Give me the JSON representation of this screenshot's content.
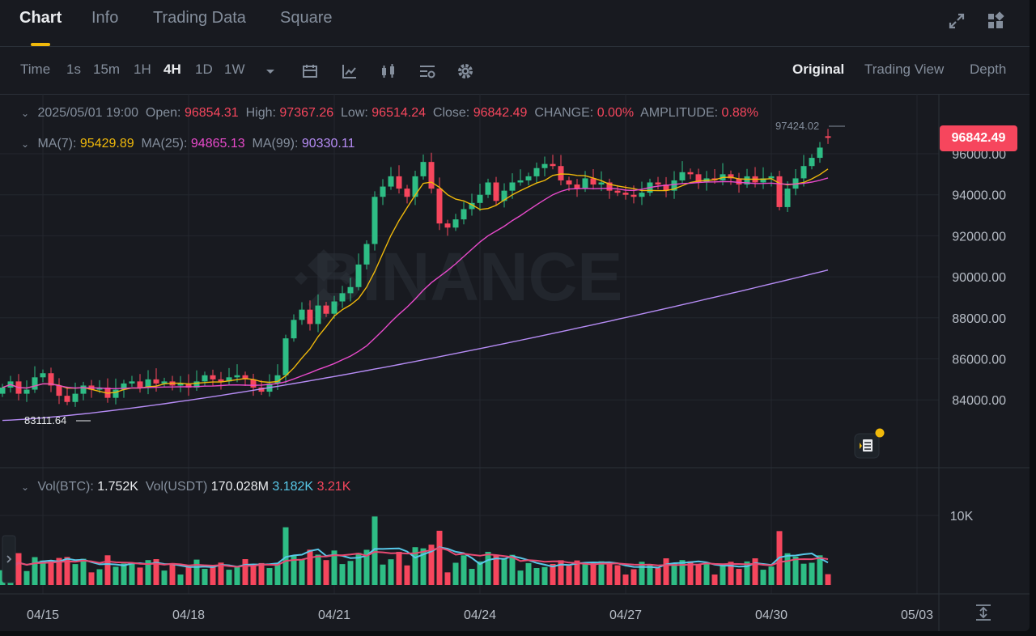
{
  "tabs": [
    {
      "label": "Chart",
      "active": true
    },
    {
      "label": "Info",
      "active": false
    },
    {
      "label": "Trading Data",
      "active": false
    },
    {
      "label": "Square",
      "active": false
    }
  ],
  "toolbar": {
    "intervals": [
      "Time",
      "1s",
      "15m",
      "1H",
      "4H",
      "1D",
      "1W"
    ],
    "active_interval": "4H",
    "views": [
      "Original",
      "Trading View",
      "Depth"
    ],
    "active_view": "Original"
  },
  "ohlc": {
    "datetime": "2025/05/01 19:00",
    "open_label": "Open:",
    "open": "96854.31",
    "high_label": "High:",
    "high": "97367.26",
    "low_label": "Low:",
    "low": "96514.24",
    "close_label": "Close:",
    "close": "96842.49",
    "change_label": "CHANGE:",
    "change": "0.00%",
    "amplitude_label": "AMPLITUDE:",
    "amplitude": "0.88%"
  },
  "ma": {
    "ma7_label": "MA(7):",
    "ma7": "95429.89",
    "ma25_label": "MA(25):",
    "ma25": "94865.13",
    "ma99_label": "MA(99):",
    "ma99": "90330.11"
  },
  "volume": {
    "btc_label": "Vol(BTC):",
    "btc": "1.752K",
    "usdt_label": "Vol(USDT)",
    "usdt": "170.028M",
    "ma1": "3.182K",
    "ma2": "3.21K"
  },
  "markers": {
    "high_marker": "97424.02",
    "low_marker": "83111.64",
    "current_price": "96842.49"
  },
  "watermark": "BINANCE",
  "colors": {
    "up": "#2ebd85",
    "down": "#f6465d",
    "ma7": "#f0b90b",
    "ma25": "#e84acb",
    "ma99": "#b68cf5",
    "accent": "#f0b90b"
  },
  "chart_data": {
    "type": "candlestick",
    "price_axis": {
      "ticks": [
        "96000.00",
        "94000.00",
        "92000.00",
        "90000.00",
        "88000.00",
        "86000.00",
        "84000.00"
      ],
      "values": [
        96000,
        94000,
        92000,
        90000,
        88000,
        86000,
        84000
      ]
    },
    "volume_axis": {
      "ticks": [
        "10K"
      ],
      "values": [
        10000
      ]
    },
    "x_ticks": [
      "04/15",
      "04/18",
      "04/21",
      "04/24",
      "04/27",
      "04/30",
      "05/03"
    ],
    "close_series": [
      84600,
      84900,
      84300,
      84500,
      85100,
      85300,
      84700,
      84200,
      83900,
      84300,
      84700,
      84500,
      84600,
      84100,
      84500,
      84800,
      84900,
      84600,
      85000,
      84800,
      84900,
      84700,
      84800,
      84600,
      84900,
      85200,
      85000,
      84900,
      85100,
      85200,
      85000,
      84600,
      84400,
      84800,
      85200,
      87000,
      87900,
      88400,
      87700,
      88600,
      88200,
      88800,
      89200,
      89500,
      90600,
      91600,
      93900,
      94400,
      94900,
      94300,
      93900,
      94900,
      95600,
      94300,
      92600,
      92400,
      92800,
      93300,
      93600,
      94000,
      94600,
      93700,
      94200,
      94600,
      94700,
      94900,
      95300,
      95500,
      95400,
      94700,
      94500,
      94300,
      94800,
      94500,
      94600,
      94200,
      94100,
      94000,
      93900,
      94100,
      94600,
      94500,
      94200,
      94700,
      95100,
      95000,
      94600,
      94800,
      94700,
      95000,
      94800,
      94500,
      94900,
      94600,
      94800,
      94900,
      93400,
      94300,
      94800,
      95400,
      95800,
      96300,
      96800
    ]
  }
}
